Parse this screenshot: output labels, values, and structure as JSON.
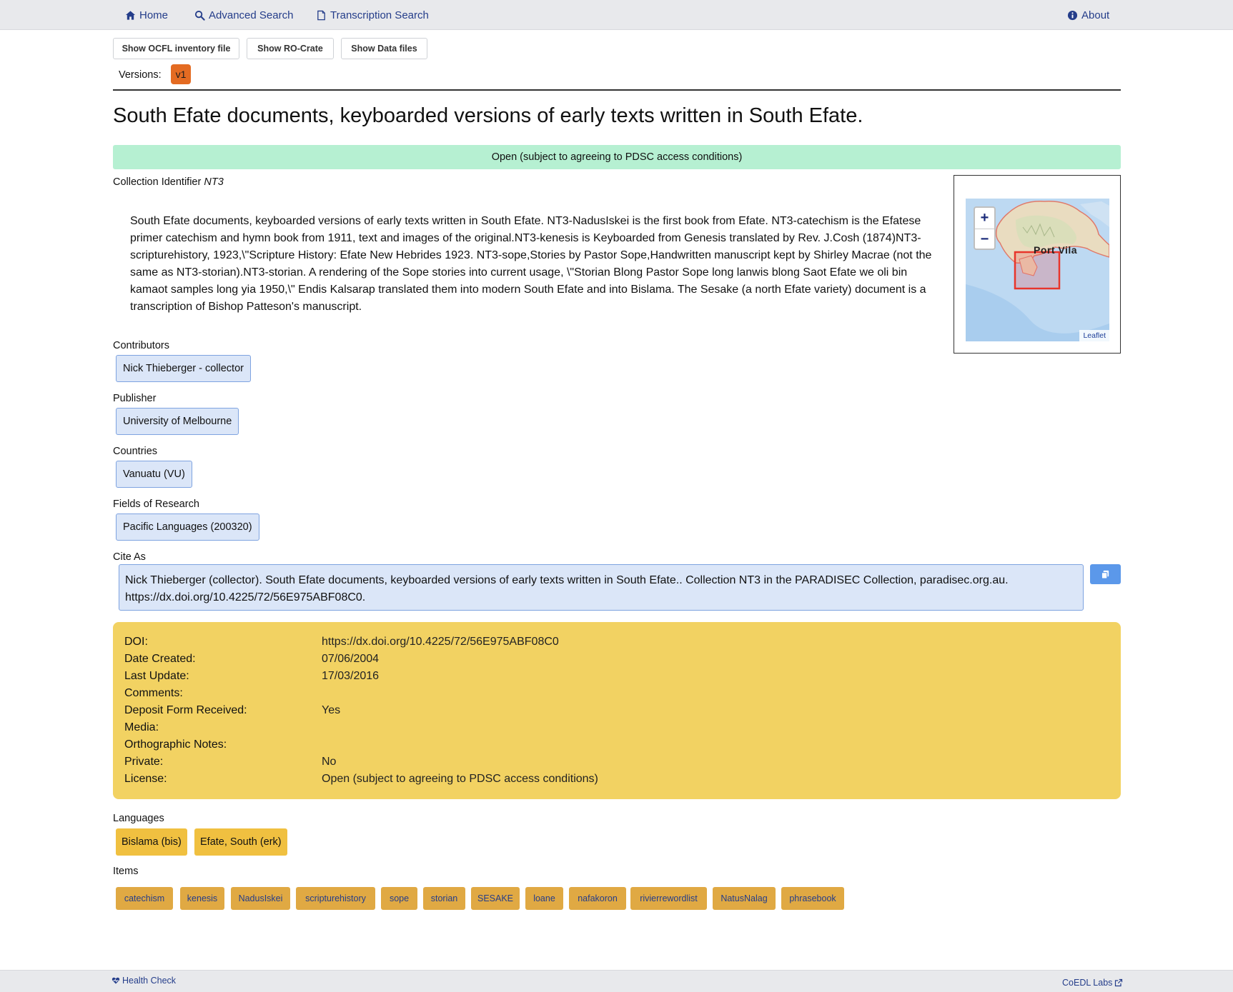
{
  "nav": {
    "home": "Home",
    "advanced_search": "Advanced Search",
    "transcription_search": "Transcription Search",
    "about": "About"
  },
  "toolbar": {
    "show_ocfl": "Show OCFL inventory file",
    "show_ro_crate": "Show RO-Crate",
    "show_data_files": "Show Data files"
  },
  "versions": {
    "label": "Versions:",
    "current": "v1"
  },
  "title": "South Efate documents, keyboarded versions of early texts written in South Efate.",
  "access_banner": "Open (subject to agreeing to PDSC access conditions)",
  "collection_identifier": {
    "label": "Collection Identifier",
    "value": "NT3"
  },
  "description": "South Efate documents, keyboarded versions of early texts written in South Efate. NT3-NadusIskei is the first book from Efate. NT3-catechism is the Efatese primer catechism and hymn book from 1911, text and images of the original.NT3-kenesis is Keyboarded from Genesis translated by Rev. J.Cosh (1874)NT3-scripturehistory, 1923,\\\"Scripture History: Efate New Hebrides 1923. NT3-sope,Stories by Pastor Sope,Handwritten manuscript kept by Shirley Macrae (not the same as NT3-storian).NT3-storian. A rendering of the Sope stories into current usage, \\\"Storian Blong Pastor Sope long lanwis blong Saot Efate we oli bin kamaot samples long yia 1950,\\\" Endis Kalsarap translated them into modern South Efate and into Bislama. The Sesake (a north Efate variety) document is a transcription of Bishop Patteson's manuscript.",
  "map": {
    "zoom_in": "+",
    "zoom_out": "−",
    "place_label": "Port Vila",
    "attribution": "Leaflet"
  },
  "contributors": {
    "label": "Contributors",
    "items": [
      "Nick Thieberger - collector"
    ]
  },
  "publisher": {
    "label": "Publisher",
    "value": "University of Melbourne"
  },
  "countries": {
    "label": "Countries",
    "value": "Vanuatu (VU)"
  },
  "fields_of_research": {
    "label": "Fields of Research",
    "value": "Pacific Languages (200320)"
  },
  "cite_as": {
    "label": "Cite As",
    "text": "Nick Thieberger (collector). South Efate documents, keyboarded versions of early texts written in South Efate.. Collection NT3 in the PARADISEC Collection, paradisec.org.au. https://dx.doi.org/10.4225/72/56E975ABF08C0."
  },
  "metadata": [
    {
      "label": "DOI:",
      "value": "https://dx.doi.org/10.4225/72/56E975ABF08C0"
    },
    {
      "label": "Date Created:",
      "value": "07/06/2004"
    },
    {
      "label": "Last Update:",
      "value": "17/03/2016"
    },
    {
      "label": "Comments:",
      "value": ""
    },
    {
      "label": "Deposit Form Received:",
      "value": "Yes"
    },
    {
      "label": "Media:",
      "value": ""
    },
    {
      "label": "Orthographic Notes:",
      "value": ""
    },
    {
      "label": "Private:",
      "value": "No"
    },
    {
      "label": "License:",
      "value": "Open (subject to agreeing to PDSC access conditions)"
    }
  ],
  "languages": {
    "label": "Languages",
    "items": [
      "Bislama (bis)",
      "Efate, South (erk)"
    ]
  },
  "items": {
    "label": "Items",
    "list": [
      "catechism",
      "kenesis",
      "NadusIskei",
      "scripturehistory",
      "sope",
      "storian",
      "SESAKE",
      "loane",
      "nafakoron",
      "rivierrewordlist",
      "NatusNalag",
      "phrasebook"
    ]
  },
  "footer": {
    "health_check": "Health Check",
    "coedl_labs": "CoEDL Labs"
  },
  "colors": {
    "nav_bg": "#e8e9ec",
    "link": "#243d8a",
    "version_badge": "#e46b22",
    "access_green": "#b6f0d2",
    "chip_blue": "#dbe6f8",
    "metadata_yellow": "#f2d262",
    "language_chip": "#f0c040",
    "item_chip": "#e0a943",
    "copy_button": "#5b98ea"
  }
}
